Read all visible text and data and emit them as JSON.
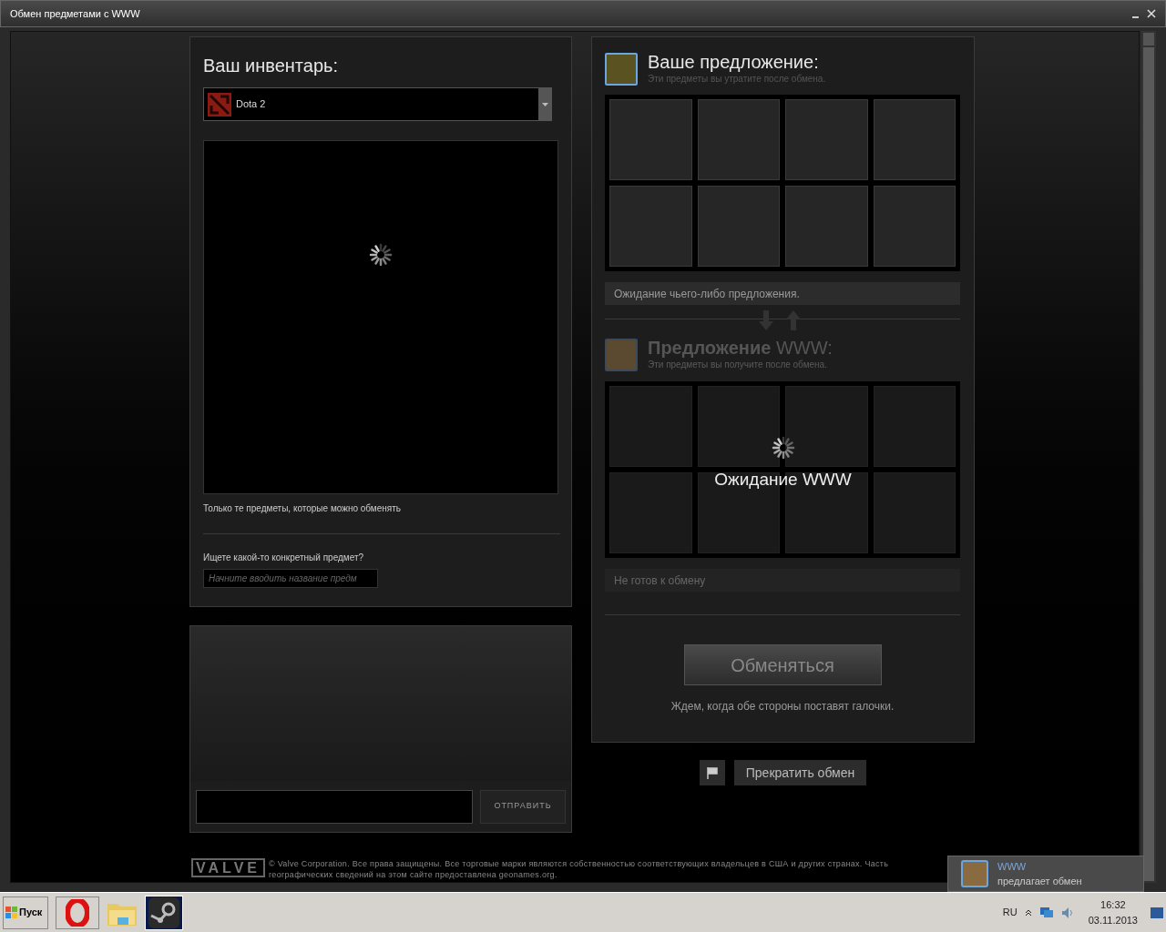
{
  "window": {
    "title": "Обмен предметами с WWW"
  },
  "inventory": {
    "title": "Ваш инвентарь:",
    "game_select": {
      "value": "Dota 2"
    },
    "loading": true,
    "note": "Только те предметы, которые можно обменять",
    "search_label": "Ищете какой-то конкретный предмет?",
    "search": {
      "placeholder": "Начните вводить название предм"
    }
  },
  "chat": {
    "send_button": "ОТПРАВИТЬ"
  },
  "your_offer": {
    "title": "Ваше предложение:",
    "subtitle": "Эти предметы вы утратите после обмена.",
    "status": "Ожидание чьего-либо предложения."
  },
  "their_offer": {
    "title": "**Предложение** WWW:",
    "subtitle": "Эти предметы вы получите после обмена.",
    "loading": true,
    "waiting": "Ожидание WWW",
    "status": "Не готов к обмену"
  },
  "trade_button": {
    "label": "Обменяться",
    "disabled": true
  },
  "trade_hint": "Ждем, когда обе стороны поставят галочки.",
  "cancel_button": "Прекратить обмен",
  "footer": {
    "logo": "VALVE",
    "copyright": "© Valve Corporation. Все права защищены. Все торговые марки являются собственностью соответствующих владельцев в США и других странах. Часть географических сведений на этом сайте предоставлена geonames.org."
  },
  "notification": {
    "name": "WWW",
    "message": "предлагает обмен"
  },
  "taskbar": {
    "start": "Пуск",
    "language": "RU",
    "time": "16:32",
    "date": "03.11.2013"
  }
}
